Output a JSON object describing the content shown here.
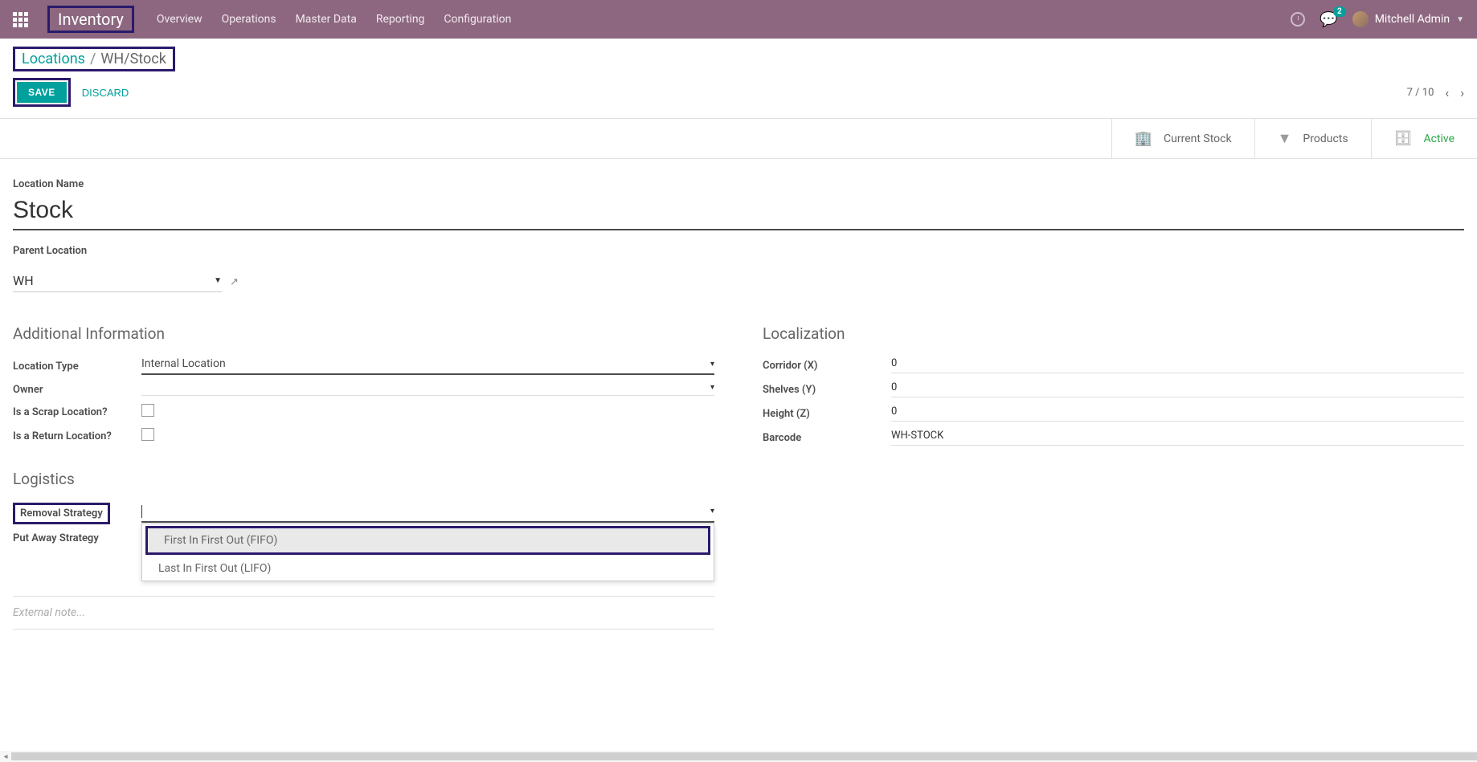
{
  "header": {
    "brand": "Inventory",
    "nav": [
      "Overview",
      "Operations",
      "Master Data",
      "Reporting",
      "Configuration"
    ],
    "messages_count": "2",
    "user_name": "Mitchell Admin"
  },
  "breadcrumb": {
    "root": "Locations",
    "current": "WH/Stock"
  },
  "actions": {
    "save": "SAVE",
    "discard": "DISCARD",
    "pager": "7 / 10"
  },
  "statbar": {
    "current_stock": "Current Stock",
    "products": "Products",
    "active": "Active"
  },
  "main": {
    "location_name_label": "Location Name",
    "location_name_value": "Stock",
    "parent_location_label": "Parent Location",
    "parent_location_value": "WH"
  },
  "additional": {
    "title": "Additional Information",
    "location_type_label": "Location Type",
    "location_type_value": "Internal Location",
    "owner_label": "Owner",
    "owner_value": "",
    "scrap_label": "Is a Scrap Location?",
    "return_label": "Is a Return Location?"
  },
  "localization": {
    "title": "Localization",
    "corridor_label": "Corridor (X)",
    "corridor_value": "0",
    "shelves_label": "Shelves (Y)",
    "shelves_value": "0",
    "height_label": "Height (Z)",
    "height_value": "0",
    "barcode_label": "Barcode",
    "barcode_value": "WH-STOCK"
  },
  "logistics": {
    "title": "Logistics",
    "removal_label": "Removal Strategy",
    "removal_value": "",
    "putaway_label": "Put Away Strategy",
    "dropdown": {
      "fifo": "First In First Out (FIFO)",
      "lifo": "Last In First Out (LIFO)"
    }
  },
  "notes_placeholder": "External note..."
}
